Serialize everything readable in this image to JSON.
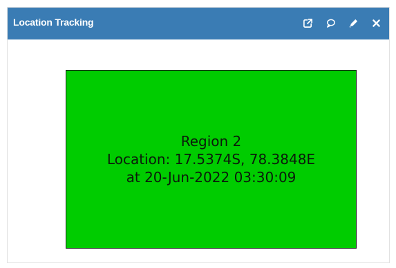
{
  "window": {
    "title": "Location Tracking",
    "actions": [
      {
        "name": "popout",
        "icon": "external-link-icon"
      },
      {
        "name": "comment",
        "icon": "comment-icon"
      },
      {
        "name": "edit",
        "icon": "pencil-icon"
      },
      {
        "name": "close",
        "icon": "close-icon"
      }
    ]
  },
  "region": {
    "name": "Region 2",
    "location": "Location: 17.5374S, 78.3848E",
    "timestamp": "at 20-Jun-2022 03:30:09",
    "status_color": "#00cc00"
  },
  "colors": {
    "header": "#3a7cb4",
    "header_text": "#ffffff"
  }
}
